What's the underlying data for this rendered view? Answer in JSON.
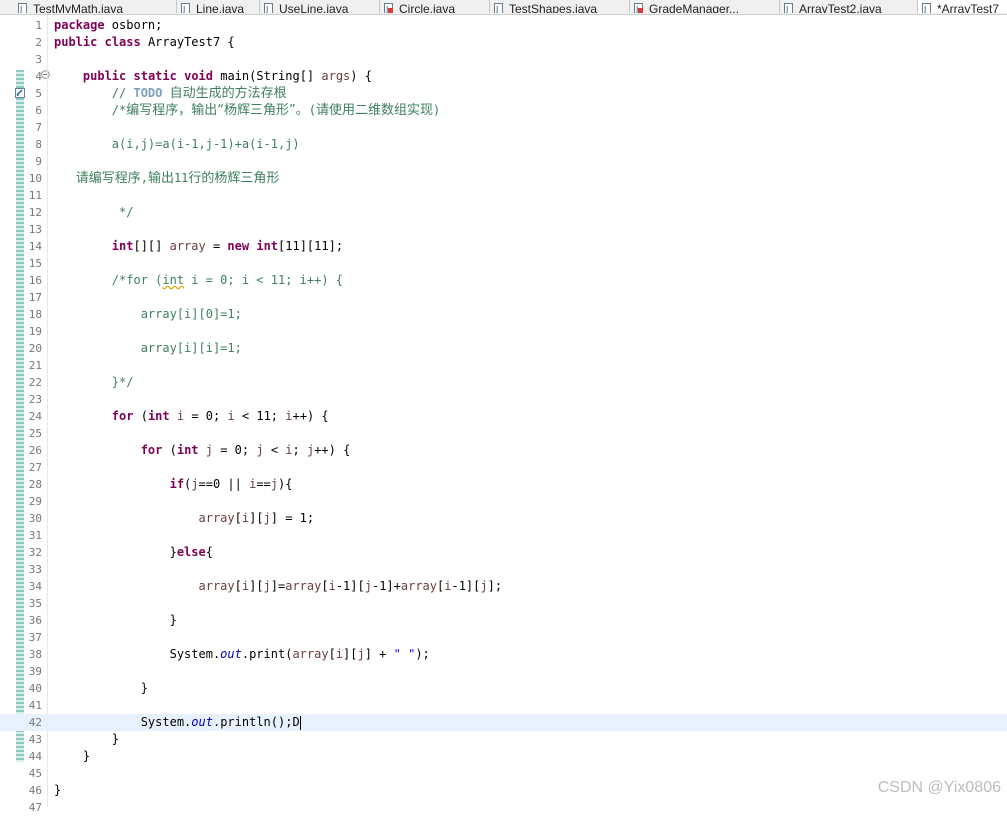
{
  "tabs": [
    {
      "label": "TestMyMath.java",
      "icon": "java-file-icon",
      "active": false
    },
    {
      "label": "Line.java",
      "icon": "java-file-icon",
      "active": false
    },
    {
      "label": "UseLine.java",
      "icon": "java-file-icon",
      "active": false
    },
    {
      "label": "Circle.java",
      "icon": "java-error-file-icon",
      "active": false
    },
    {
      "label": "TestShapes.java",
      "icon": "java-file-icon",
      "active": false
    },
    {
      "label": "GradeManager...",
      "icon": "java-error-file-icon",
      "active": false
    },
    {
      "label": "ArrayTest2.java",
      "icon": "java-file-icon",
      "active": false
    },
    {
      "label": "*ArrayTest7",
      "icon": "java-file-icon",
      "active": true
    }
  ],
  "lines": [
    {
      "n": "1",
      "text": "package osborn;"
    },
    {
      "n": "2",
      "text": "public class ArrayTest7 {"
    },
    {
      "n": "3",
      "text": ""
    },
    {
      "n": "4",
      "text": "    public static void main(String[] args) {"
    },
    {
      "n": "5",
      "text": "        // TODO 自动生成的方法存根"
    },
    {
      "n": "6",
      "text": "        /*编写程序，输出“杨辉三角形”。(请使用二维数组实现)"
    },
    {
      "n": "7",
      "text": ""
    },
    {
      "n": "8",
      "text": "        a(i,j)=a(i-1,j-1)+a(i-1,j)"
    },
    {
      "n": "9",
      "text": ""
    },
    {
      "n": "10",
      "text": "   请编写程序,输出11行的杨辉三角形"
    },
    {
      "n": "11",
      "text": ""
    },
    {
      "n": "12",
      "text": "         */"
    },
    {
      "n": "13",
      "text": ""
    },
    {
      "n": "14",
      "text": "        int[][] array = new int[11][11];"
    },
    {
      "n": "15",
      "text": ""
    },
    {
      "n": "16",
      "text": "        /*for (int i = 0; i < 11; i++) {"
    },
    {
      "n": "17",
      "text": ""
    },
    {
      "n": "18",
      "text": "            array[i][0]=1;"
    },
    {
      "n": "19",
      "text": ""
    },
    {
      "n": "20",
      "text": "            array[i][i]=1;"
    },
    {
      "n": "21",
      "text": ""
    },
    {
      "n": "22",
      "text": "        }*/"
    },
    {
      "n": "23",
      "text": ""
    },
    {
      "n": "24",
      "text": "        for (int i = 0; i < 11; i++) {"
    },
    {
      "n": "25",
      "text": ""
    },
    {
      "n": "26",
      "text": "            for (int j = 0; j < i; j++) {"
    },
    {
      "n": "27",
      "text": ""
    },
    {
      "n": "28",
      "text": "                if(j==0 || i==j){"
    },
    {
      "n": "29",
      "text": ""
    },
    {
      "n": "30",
      "text": "                    array[i][j] = 1;"
    },
    {
      "n": "31",
      "text": ""
    },
    {
      "n": "32",
      "text": "                }else{"
    },
    {
      "n": "33",
      "text": ""
    },
    {
      "n": "34",
      "text": "                    array[i][j]=array[i-1][j-1]+array[i-1][j];"
    },
    {
      "n": "35",
      "text": ""
    },
    {
      "n": "36",
      "text": "                }"
    },
    {
      "n": "37",
      "text": ""
    },
    {
      "n": "38",
      "text": "                System.out.print(array[i][j] + \" \");"
    },
    {
      "n": "39",
      "text": ""
    },
    {
      "n": "40",
      "text": "            }"
    },
    {
      "n": "41",
      "text": ""
    },
    {
      "n": "42",
      "text": "            System.out.println();D"
    },
    {
      "n": "43",
      "text": "        }"
    },
    {
      "n": "44",
      "text": "    }"
    },
    {
      "n": "45",
      "text": ""
    },
    {
      "n": "46",
      "text": "}"
    },
    {
      "n": "47",
      "text": ""
    }
  ],
  "current_line": "42",
  "watermark": "CSDN @Yix0806",
  "colors": {
    "keyword": "#7f0055",
    "comment": "#3f7f5f",
    "field": "#0000c0",
    "string": "#2a00ff",
    "current_line_bg": "#e8f2fe",
    "ruler": "#8ec7c4"
  }
}
